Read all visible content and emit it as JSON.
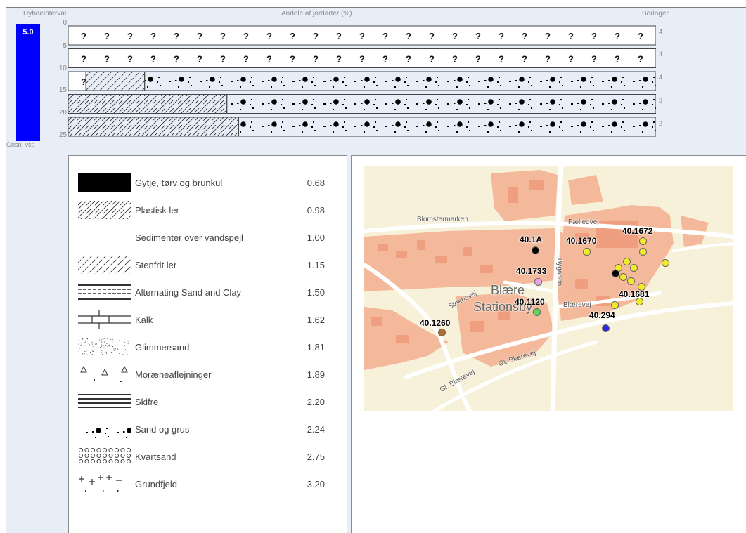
{
  "header": {
    "depth_interval_label": "Dybdeinterval",
    "shares_label": "Andele af jordarter (%)",
    "boreholes_label": "Boringer"
  },
  "average": {
    "value": "5.0",
    "label": "Gnsn. vsp",
    "color": "#0000ff"
  },
  "depth_ticks": [
    "0",
    "5",
    "10",
    "15",
    "20",
    "25"
  ],
  "profile_rows": [
    {
      "depth": "0-5",
      "count": "4",
      "segments": [
        {
          "type": "unknown",
          "percent": 100
        }
      ]
    },
    {
      "depth": "5-10",
      "count": "4",
      "segments": [
        {
          "type": "unknown",
          "percent": 100
        }
      ]
    },
    {
      "depth": "10-15",
      "count": "4",
      "segments": [
        {
          "type": "unknown",
          "percent": 3
        },
        {
          "type": "stenfrit-ler",
          "percent": 10
        },
        {
          "type": "sand-og-grus",
          "percent": 87
        }
      ]
    },
    {
      "depth": "15-20",
      "count": "3",
      "segments": [
        {
          "type": "plastisk-ler",
          "percent": 27
        },
        {
          "type": "sand-og-grus",
          "percent": 73
        }
      ]
    },
    {
      "depth": "20-25",
      "count": "2",
      "segments": [
        {
          "type": "plastisk-ler",
          "percent": 29
        },
        {
          "type": "sand-og-grus",
          "percent": 71
        }
      ]
    }
  ],
  "unknown_symbol": "?",
  "legend": [
    {
      "id": "gytje",
      "name": "Gytje, tørv og brunkul",
      "value": "0.68"
    },
    {
      "id": "plastisk-ler",
      "name": "Plastisk ler",
      "value": "0.98"
    },
    {
      "id": "sedimenter",
      "name": "Sedimenter over vandspejl",
      "value": "1.00"
    },
    {
      "id": "stenfrit-ler",
      "name": "Stenfrit ler",
      "value": "1.15"
    },
    {
      "id": "alternating",
      "name": "Alternating Sand and Clay",
      "value": "1.50"
    },
    {
      "id": "kalk",
      "name": "Kalk",
      "value": "1.62"
    },
    {
      "id": "glimmersand",
      "name": "Glimmersand",
      "value": "1.81"
    },
    {
      "id": "moraene",
      "name": "Moræneaflejninger",
      "value": "1.89"
    },
    {
      "id": "skifre",
      "name": "Skifre",
      "value": "2.20"
    },
    {
      "id": "sand-og-grus",
      "name": "Sand og grus",
      "value": "2.24"
    },
    {
      "id": "kvartsand",
      "name": "Kvartsand",
      "value": "2.75"
    },
    {
      "id": "grundfjeld",
      "name": "Grundfjeld",
      "value": "3.20"
    }
  ],
  "map": {
    "town_line1": "Blære",
    "town_line2": "Stationsby",
    "streets": [
      "Blomstermarken",
      "Fælledvej",
      "Steensvej",
      "Blærevej",
      "Gl. Blærevej",
      "Gl. Blærevej",
      "Bygaden"
    ],
    "borehole_labels": [
      "40.1A",
      "40.1733",
      "40.1120",
      "40.1260",
      "40.1670",
      "40.1672",
      "40.1681",
      "40.294"
    ],
    "colors": {
      "land": "#f7f1da",
      "buildings": "#f3b99a",
      "roads": "#ffffff",
      "black_point": "#000000",
      "pink_point": "#e8a6e8",
      "green_point": "#5ed35e",
      "brown_point": "#b46e28",
      "yellow_point": "#f4ea2c",
      "blue_point": "#2b2bdc"
    }
  }
}
